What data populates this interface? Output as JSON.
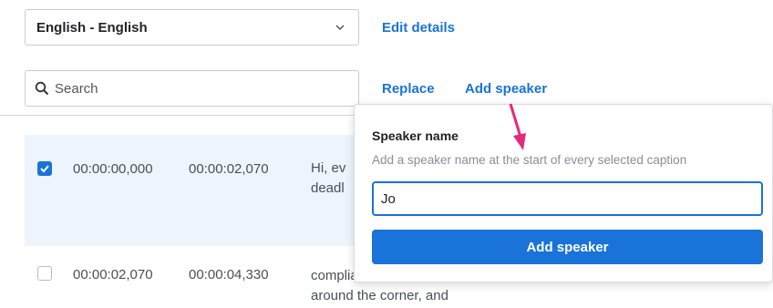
{
  "language_select": {
    "value": "English - English",
    "icon": "chevron-down-icon"
  },
  "header_links": {
    "edit_details": "Edit details",
    "replace": "Replace",
    "add_speaker": "Add speaker"
  },
  "search": {
    "placeholder": "Search",
    "icon": "search-icon"
  },
  "captions": [
    {
      "selected": true,
      "start": "00:00:00,000",
      "end": "00:00:02,070",
      "text_line1": "Hi, ev",
      "text_line2": "deadl"
    },
    {
      "selected": false,
      "start": "00:00:02,070",
      "end": "00:00:04,330",
      "text_line1": "compliance is just",
      "text_line2": "around the corner, and"
    }
  ],
  "speaker_popover": {
    "title": "Speaker name",
    "help": "Add a speaker name at the start of every selected caption",
    "input_value": "Jo",
    "button_label": "Add speaker"
  },
  "colors": {
    "accent": "#1a73d9",
    "selected_row": "#eef4fc",
    "annotation_arrow": "#e8287a"
  }
}
